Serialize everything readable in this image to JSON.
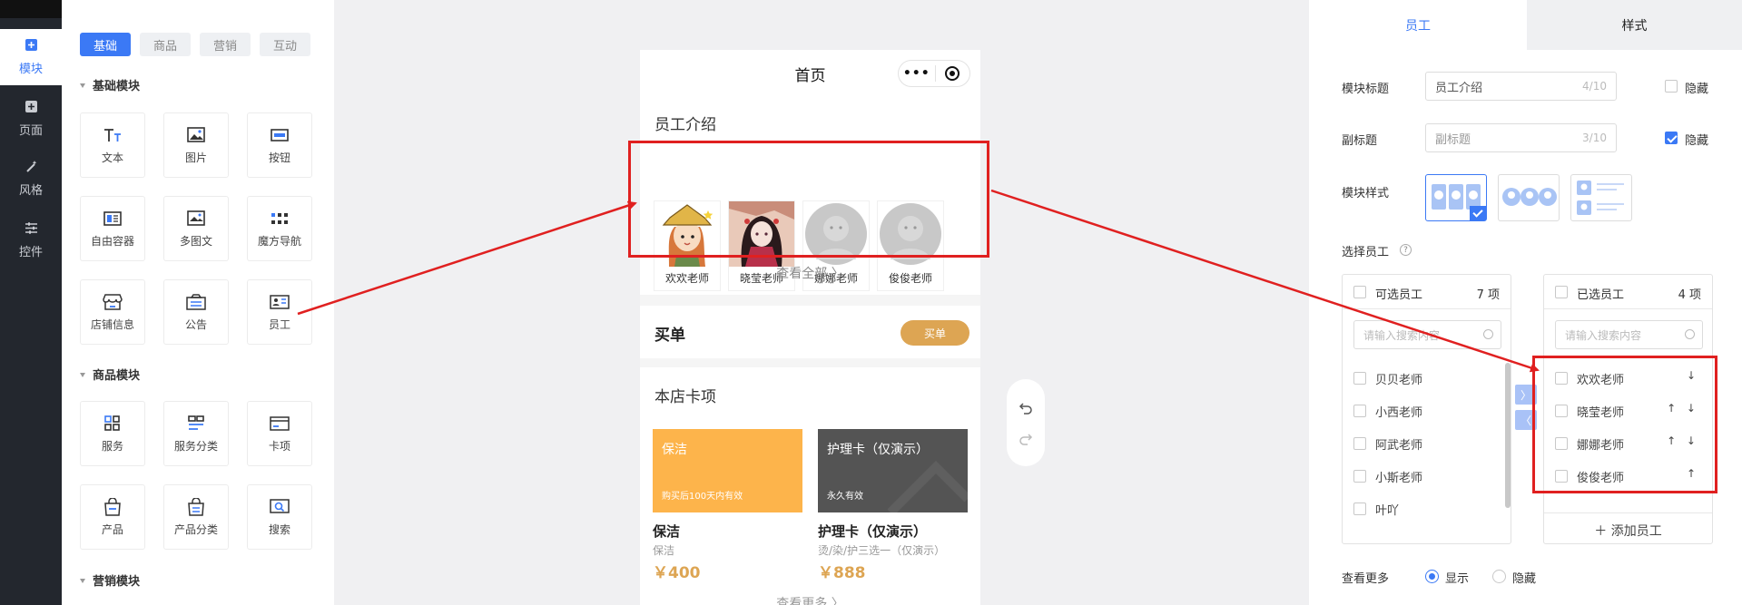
{
  "left_rail": {
    "items": [
      {
        "label": "模块",
        "icon": "plus-square-icon",
        "active": true
      },
      {
        "label": "页面",
        "icon": "page-icon",
        "active": false
      },
      {
        "label": "风格",
        "icon": "magic-wand-icon",
        "active": false
      },
      {
        "label": "控件",
        "icon": "sliders-icon",
        "active": false
      }
    ]
  },
  "module_panel": {
    "tabs": [
      {
        "label": "基础",
        "active": true
      },
      {
        "label": "商品",
        "active": false
      },
      {
        "label": "营销",
        "active": false
      },
      {
        "label": "互动",
        "active": false
      }
    ],
    "sections": [
      {
        "title": "基础模块",
        "tiles": [
          {
            "label": "文本",
            "icon": "text-icon"
          },
          {
            "label": "图片",
            "icon": "image-icon"
          },
          {
            "label": "按钮",
            "icon": "button-icon"
          },
          {
            "label": "自由容器",
            "icon": "container-icon"
          },
          {
            "label": "多图文",
            "icon": "multi-image-icon"
          },
          {
            "label": "魔方导航",
            "icon": "grid-nav-icon"
          },
          {
            "label": "店铺信息",
            "icon": "store-icon"
          },
          {
            "label": "公告",
            "icon": "notice-icon"
          },
          {
            "label": "员工",
            "icon": "staff-card-icon"
          }
        ]
      },
      {
        "title": "商品模块",
        "tiles": [
          {
            "label": "服务",
            "icon": "service-icon"
          },
          {
            "label": "服务分类",
            "icon": "service-category-icon"
          },
          {
            "label": "卡项",
            "icon": "card-icon"
          },
          {
            "label": "产品",
            "icon": "bag-icon"
          },
          {
            "label": "产品分类",
            "icon": "bag-category-icon"
          },
          {
            "label": "搜索",
            "icon": "search-window-icon"
          }
        ]
      },
      {
        "title": "营销模块",
        "tiles": []
      }
    ]
  },
  "phone": {
    "title": "首页",
    "capsule_dots": "•••",
    "staff_section": {
      "title": "员工介绍",
      "staff": [
        {
          "name": "欢欢老师",
          "avatar": "cartoon-girl"
        },
        {
          "name": "晓莹老师",
          "avatar": "anime-girl"
        },
        {
          "name": "娜娜老师",
          "avatar": "default"
        },
        {
          "name": "俊俊老师",
          "avatar": "default"
        }
      ],
      "view_all": "查看全部 〉"
    },
    "buy_section": {
      "title": "买单",
      "button": "买单"
    },
    "card_section": {
      "title": "本店卡项",
      "cards": [
        {
          "image_title": "保洁",
          "image_note": "购买后100天内有效",
          "name": "保洁",
          "desc": "保洁",
          "price": "￥400",
          "bg": "#fdb44b"
        },
        {
          "image_title": "护理卡（仅演示）",
          "image_note": "永久有效",
          "name": "护理卡（仅演示）",
          "desc": "烫/染/护三选一（仅演示）",
          "price": "￥888",
          "bg": "#545454"
        }
      ],
      "view_more": "查看更多 〉"
    }
  },
  "settings": {
    "tabs": [
      {
        "label": "员工",
        "active": true
      },
      {
        "label": "样式",
        "active": false
      }
    ],
    "module_title": {
      "label": "模块标题",
      "value": "员工介绍",
      "count": "4/10",
      "hide_label": "隐藏",
      "hidden": false
    },
    "subtitle": {
      "label": "副标题",
      "placeholder": "副标题",
      "count": "3/10",
      "hide_label": "隐藏",
      "hidden": true
    },
    "module_style": {
      "label": "模块样式",
      "selected_index": 0
    },
    "select_staff": {
      "label": "选择员工"
    },
    "available": {
      "title": "可选员工",
      "count": "7 项",
      "search_placeholder": "请输入搜索内容",
      "items": [
        "贝贝老师",
        "小西老师",
        "阿武老师",
        "小斯老师",
        "叶吖"
      ]
    },
    "selected": {
      "title": "已选员工",
      "count": "4 项",
      "search_placeholder": "请输入搜索内容",
      "items": [
        {
          "name": "欢欢老师",
          "arrows": "↓"
        },
        {
          "name": "晓莹老师",
          "arrows": "↑ ↓"
        },
        {
          "name": "娜娜老师",
          "arrows": "↑ ↓"
        },
        {
          "name": "俊俊老师",
          "arrows": "↑"
        }
      ],
      "add_button": "＋ 添加员工"
    },
    "transfer": {
      "right": "〉",
      "left": "〈"
    },
    "view_more": {
      "label": "查看更多",
      "options": [
        {
          "label": "显示",
          "selected": true
        },
        {
          "label": "隐藏",
          "selected": false
        }
      ]
    }
  },
  "colors": {
    "accent": "#3b79f5",
    "gold": "#dda553",
    "highlight": "#e02020"
  }
}
